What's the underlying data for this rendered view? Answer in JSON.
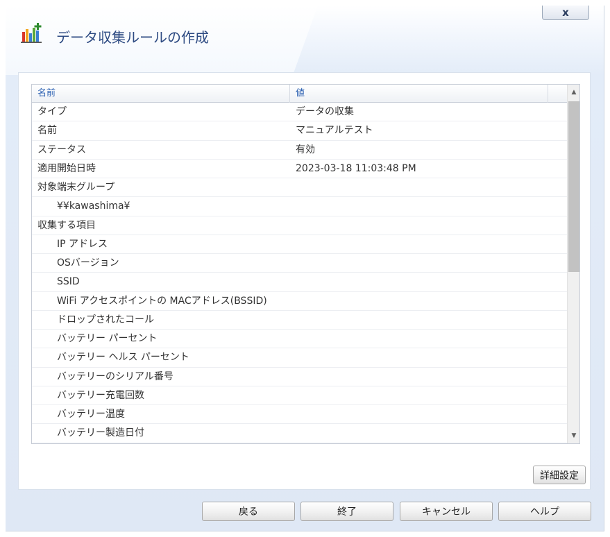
{
  "dialog": {
    "title": "データ収集ルールの作成",
    "close_label": "x"
  },
  "grid": {
    "columns": {
      "name": "名前",
      "value": "値"
    },
    "rows": [
      {
        "name": "タイプ",
        "value": "データの収集",
        "indent": false
      },
      {
        "name": "名前",
        "value": "マニュアルテスト",
        "indent": false
      },
      {
        "name": "ステータス",
        "value": "有効",
        "indent": false
      },
      {
        "name": "適用開始日時",
        "value": "2023-03-18 11:03:48 PM",
        "indent": false
      },
      {
        "name": "対象端末グループ",
        "value": "",
        "indent": false
      },
      {
        "name": "¥¥kawashima¥",
        "value": "",
        "indent": true
      },
      {
        "name": "収集する項目",
        "value": "",
        "indent": false
      },
      {
        "name": "IP アドレス",
        "value": "",
        "indent": true
      },
      {
        "name": "OSバージョン",
        "value": "",
        "indent": true
      },
      {
        "name": "SSID",
        "value": "",
        "indent": true
      },
      {
        "name": "WiFi アクセスポイントの MACアドレス(BSSID)",
        "value": "",
        "indent": true
      },
      {
        "name": "ドロップされたコール",
        "value": "",
        "indent": true
      },
      {
        "name": "バッテリー パーセント",
        "value": "",
        "indent": true
      },
      {
        "name": "バッテリー ヘルス パーセント",
        "value": "",
        "indent": true
      },
      {
        "name": "バッテリーのシリアル番号",
        "value": "",
        "indent": true
      },
      {
        "name": "バッテリー充電回数",
        "value": "",
        "indent": true
      },
      {
        "name": "バッテリー温度",
        "value": "",
        "indent": true
      },
      {
        "name": "バッテリー製造日付",
        "value": "",
        "indent": true
      }
    ]
  },
  "buttons": {
    "detail": "詳細設定",
    "back": "戻る",
    "finish": "終了",
    "cancel": "キャンセル",
    "help": "ヘルプ"
  },
  "icons": {
    "title_icon": "chart-add-icon",
    "scroll_up": "scroll-up-arrow-icon",
    "scroll_down": "scroll-down-arrow-icon"
  }
}
